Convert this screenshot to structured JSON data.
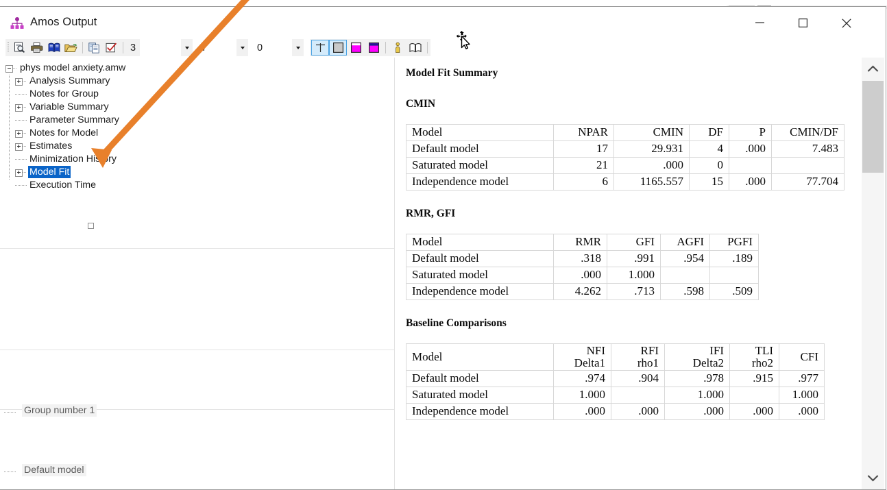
{
  "window": {
    "title": "Amos Output",
    "app_icon": "amos-tree-icon",
    "controls": {
      "minimize": "minimize-icon",
      "maximize": "maximize-icon",
      "close": "close-icon"
    }
  },
  "toolbar": {
    "buttons": [
      {
        "name": "print-preview-icon",
        "tooltip": "Print Preview"
      },
      {
        "name": "print-icon",
        "tooltip": "Print"
      },
      {
        "name": "view-text-icon",
        "tooltip": "View Text"
      },
      {
        "name": "open-file-icon",
        "tooltip": "Open File"
      },
      {
        "name": "copy-icon",
        "tooltip": "Copy to Clipboard"
      },
      {
        "name": "options-check-icon",
        "tooltip": "Options"
      }
    ],
    "decimal_places": "3",
    "field_width": "7",
    "zero_value": "0",
    "format_buttons": [
      {
        "name": "table-borders-icon",
        "active": true
      },
      {
        "name": "table-fill-icon",
        "active": true
      },
      {
        "name": "highlight-magenta-icon",
        "active": false
      },
      {
        "name": "highlight-navy-magenta-icon",
        "active": false
      },
      {
        "name": "person-icon",
        "active": false
      },
      {
        "name": "book-open-icon",
        "active": false
      }
    ]
  },
  "tree": {
    "root": "phys model anxiety.amw",
    "items": [
      {
        "label": "Analysis Summary",
        "expandable": true,
        "selected": false
      },
      {
        "label": "Notes for Group",
        "expandable": false,
        "selected": false
      },
      {
        "label": "Variable Summary",
        "expandable": true,
        "selected": false
      },
      {
        "label": "Parameter Summary",
        "expandable": false,
        "selected": false
      },
      {
        "label": "Notes for Model",
        "expandable": true,
        "selected": false
      },
      {
        "label": "Estimates",
        "expandable": true,
        "selected": false
      },
      {
        "label": "Minimization History",
        "expandable": false,
        "selected": false
      },
      {
        "label": "Model Fit",
        "expandable": true,
        "selected": true
      },
      {
        "label": "Execution Time",
        "expandable": false,
        "selected": false
      }
    ],
    "group_pane_label": "Group number 1",
    "model_pane_label": "Default model"
  },
  "output": {
    "page_title": "Model Fit Summary",
    "sections": [
      {
        "heading": "CMIN",
        "columns": [
          "Model",
          "NPAR",
          "CMIN",
          "DF",
          "P",
          "CMIN/DF"
        ],
        "rows": [
          [
            "Default model",
            "17",
            "29.931",
            "4",
            ".000",
            "7.483"
          ],
          [
            "Saturated model",
            "21",
            ".000",
            "0",
            "",
            ""
          ],
          [
            "Independence model",
            "6",
            "1165.557",
            "15",
            ".000",
            "77.704"
          ]
        ]
      },
      {
        "heading": "RMR, GFI",
        "columns": [
          "Model",
          "RMR",
          "GFI",
          "AGFI",
          "PGFI"
        ],
        "rows": [
          [
            "Default model",
            ".318",
            ".991",
            ".954",
            ".189"
          ],
          [
            "Saturated model",
            ".000",
            "1.000",
            "",
            ""
          ],
          [
            "Independence model",
            "4.262",
            ".713",
            ".598",
            ".509"
          ]
        ]
      },
      {
        "heading": "Baseline Comparisons",
        "columns_top": [
          "Model",
          "NFI",
          "RFI",
          "IFI",
          "TLI",
          "CFI"
        ],
        "columns_bottom": [
          "",
          "Delta1",
          "rho1",
          "Delta2",
          "rho2",
          ""
        ],
        "rows": [
          [
            "Default model",
            ".974",
            ".904",
            ".978",
            ".915",
            ".977"
          ],
          [
            "Saturated model",
            "1.000",
            "",
            "1.000",
            "",
            "1.000"
          ],
          [
            "Independence model",
            ".000",
            ".000",
            ".000",
            ".000",
            ".000"
          ]
        ]
      }
    ]
  },
  "scrollbar": {
    "up_arrow": "chevron-up-icon",
    "down_arrow": "chevron-down-icon"
  },
  "annotation": {
    "arrow_color": "#E8802B",
    "points_to": "Model Fit"
  },
  "colors": {
    "selection_blue": "#0A64C8",
    "magenta": "#FF00FF",
    "navy": "#1D1D8F",
    "accent_blue": "#4BA3E3"
  }
}
